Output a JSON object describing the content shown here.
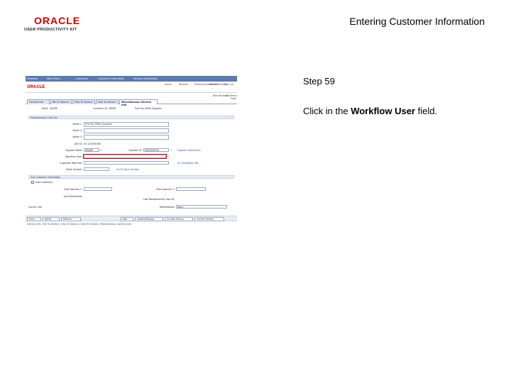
{
  "header": {
    "logo_main": "ORACLE",
    "logo_sub": "USER PRODUCTIVITY KIT",
    "title": "Entering Customer Information"
  },
  "instructions": {
    "step": "Step 59",
    "before": "Click in the ",
    "field_name": "Workflow User",
    "after": " field."
  },
  "app": {
    "topnav": [
      "Favorites",
      "Main Menu",
      "Customers",
      "Customer Information",
      "General Information"
    ],
    "brand": "ORACLE",
    "appnav": [
      "Home",
      "Worklist",
      "Performance Monitor",
      "Add to Favorites",
      "Sign out"
    ],
    "toolbar": [
      "New Window",
      "Help",
      "Personalize Page"
    ],
    "tabs": [
      "General Info",
      "Bill To Options",
      "Ship To Options",
      "Sold To Options",
      "Miscellaneous General Info"
    ],
    "setid_label": "SetID:",
    "setid_value": "SHARE",
    "customer_id_label": "Customer ID:",
    "customer_id_value": "NEWT",
    "customer_name_value": "Fine Fay Office Supplies",
    "section_misc": "Miscellaneous Cust Info",
    "name1_label": "Name 1:",
    "name1_value": "Fine Fay Office Supplies",
    "name2_label": "Name 2:",
    "name3_label": "Name 3:",
    "vat_label": "VAT ID:",
    "vat_value": "US 123456789",
    "supplier_setid_label": "Supplier SetID:",
    "supplier_setid_value": "SHARE",
    "supplier_id_label": "Supplier ID:",
    "supplier_id_value": "0000000015",
    "supplier_link": "Supplier Information",
    "workflow_user_label": "Workflow User:",
    "web_site_label": "Customer Web Site:",
    "web_link": "Go To Website URL",
    "stock_symbol_label": "Stock Symbol:",
    "stock_link": "Go To Stock Symbol",
    "section_subcust": "Sub-Customer Information",
    "subcust_checkbox_label": "Sub-Customers",
    "subcust1_label": "SubCustomer 1:",
    "subcust2_label": "SubCustomer 2:",
    "last_maintained_label": "Last Maintained:",
    "last_maintained_by_label": "Last Maintained By User ID:",
    "consol_label": "Consol. Info",
    "relationships_label": "Relationships",
    "relationships_value": "None",
    "buttons_left": [
      "Save",
      "Notify",
      "Refresh"
    ],
    "buttons_right": [
      "Add",
      "Update/Display",
      "Include History",
      "Correct History"
    ],
    "footer_links": "General Info | Bill To Options | Ship To Options | Sold To Options | Miscellaneous General Info"
  }
}
